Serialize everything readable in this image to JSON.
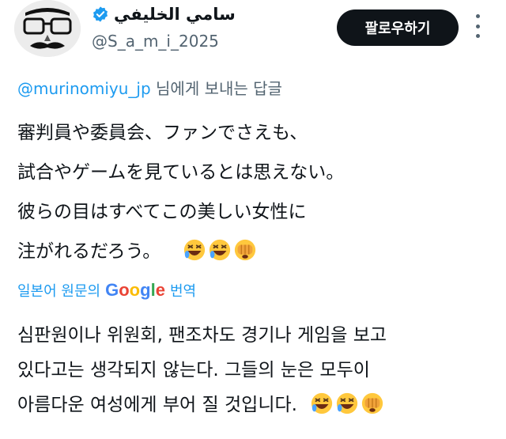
{
  "author": {
    "display_name": "سامي الخليفي",
    "handle": "@S_a_m_i_2025",
    "verified": true,
    "avatar_icon": "mustache-glasses-avatar"
  },
  "header": {
    "follow_label": "팔로우하기",
    "more_icon": "more-options-icon"
  },
  "reply_context": {
    "mention": "@murinomiyu_jp",
    "suffix": " 님에게 보내는 답글"
  },
  "tweet": {
    "text": "審判員や委員会、ファンでさえも、\n試合やゲームを見ているとは思えない。\n彼らの目はすべてこの美しい女性に\n注がれるだろう。",
    "emojis": [
      "rolling-on-floor-laughing",
      "rolling-on-floor-laughing",
      "face-with-peeking-eye"
    ]
  },
  "translation": {
    "prefix": "일본어 원문의",
    "provider": "Google",
    "suffix": "번역",
    "text": "심판원이나 위원회, 팬조차도 경기나 게임을 보고\n있다고는 생각되지 않는다. 그들의 눈은 모두이\n아름다운 여성에게 부어 질 것입니다.",
    "emojis": [
      "rolling-on-floor-laughing",
      "rolling-on-floor-laughing",
      "face-with-peeking-eye"
    ]
  },
  "colors": {
    "link": "#1d9bf0",
    "secondary_text": "#536471",
    "primary_text": "#0f1419",
    "button_bg": "#0f1419",
    "verified": "#1d9bf0",
    "google_blue": "#4285F4",
    "google_red": "#EA4335",
    "google_yellow": "#FBBC05",
    "google_green": "#34A853",
    "emoji_yellow": "#FFC83D"
  }
}
